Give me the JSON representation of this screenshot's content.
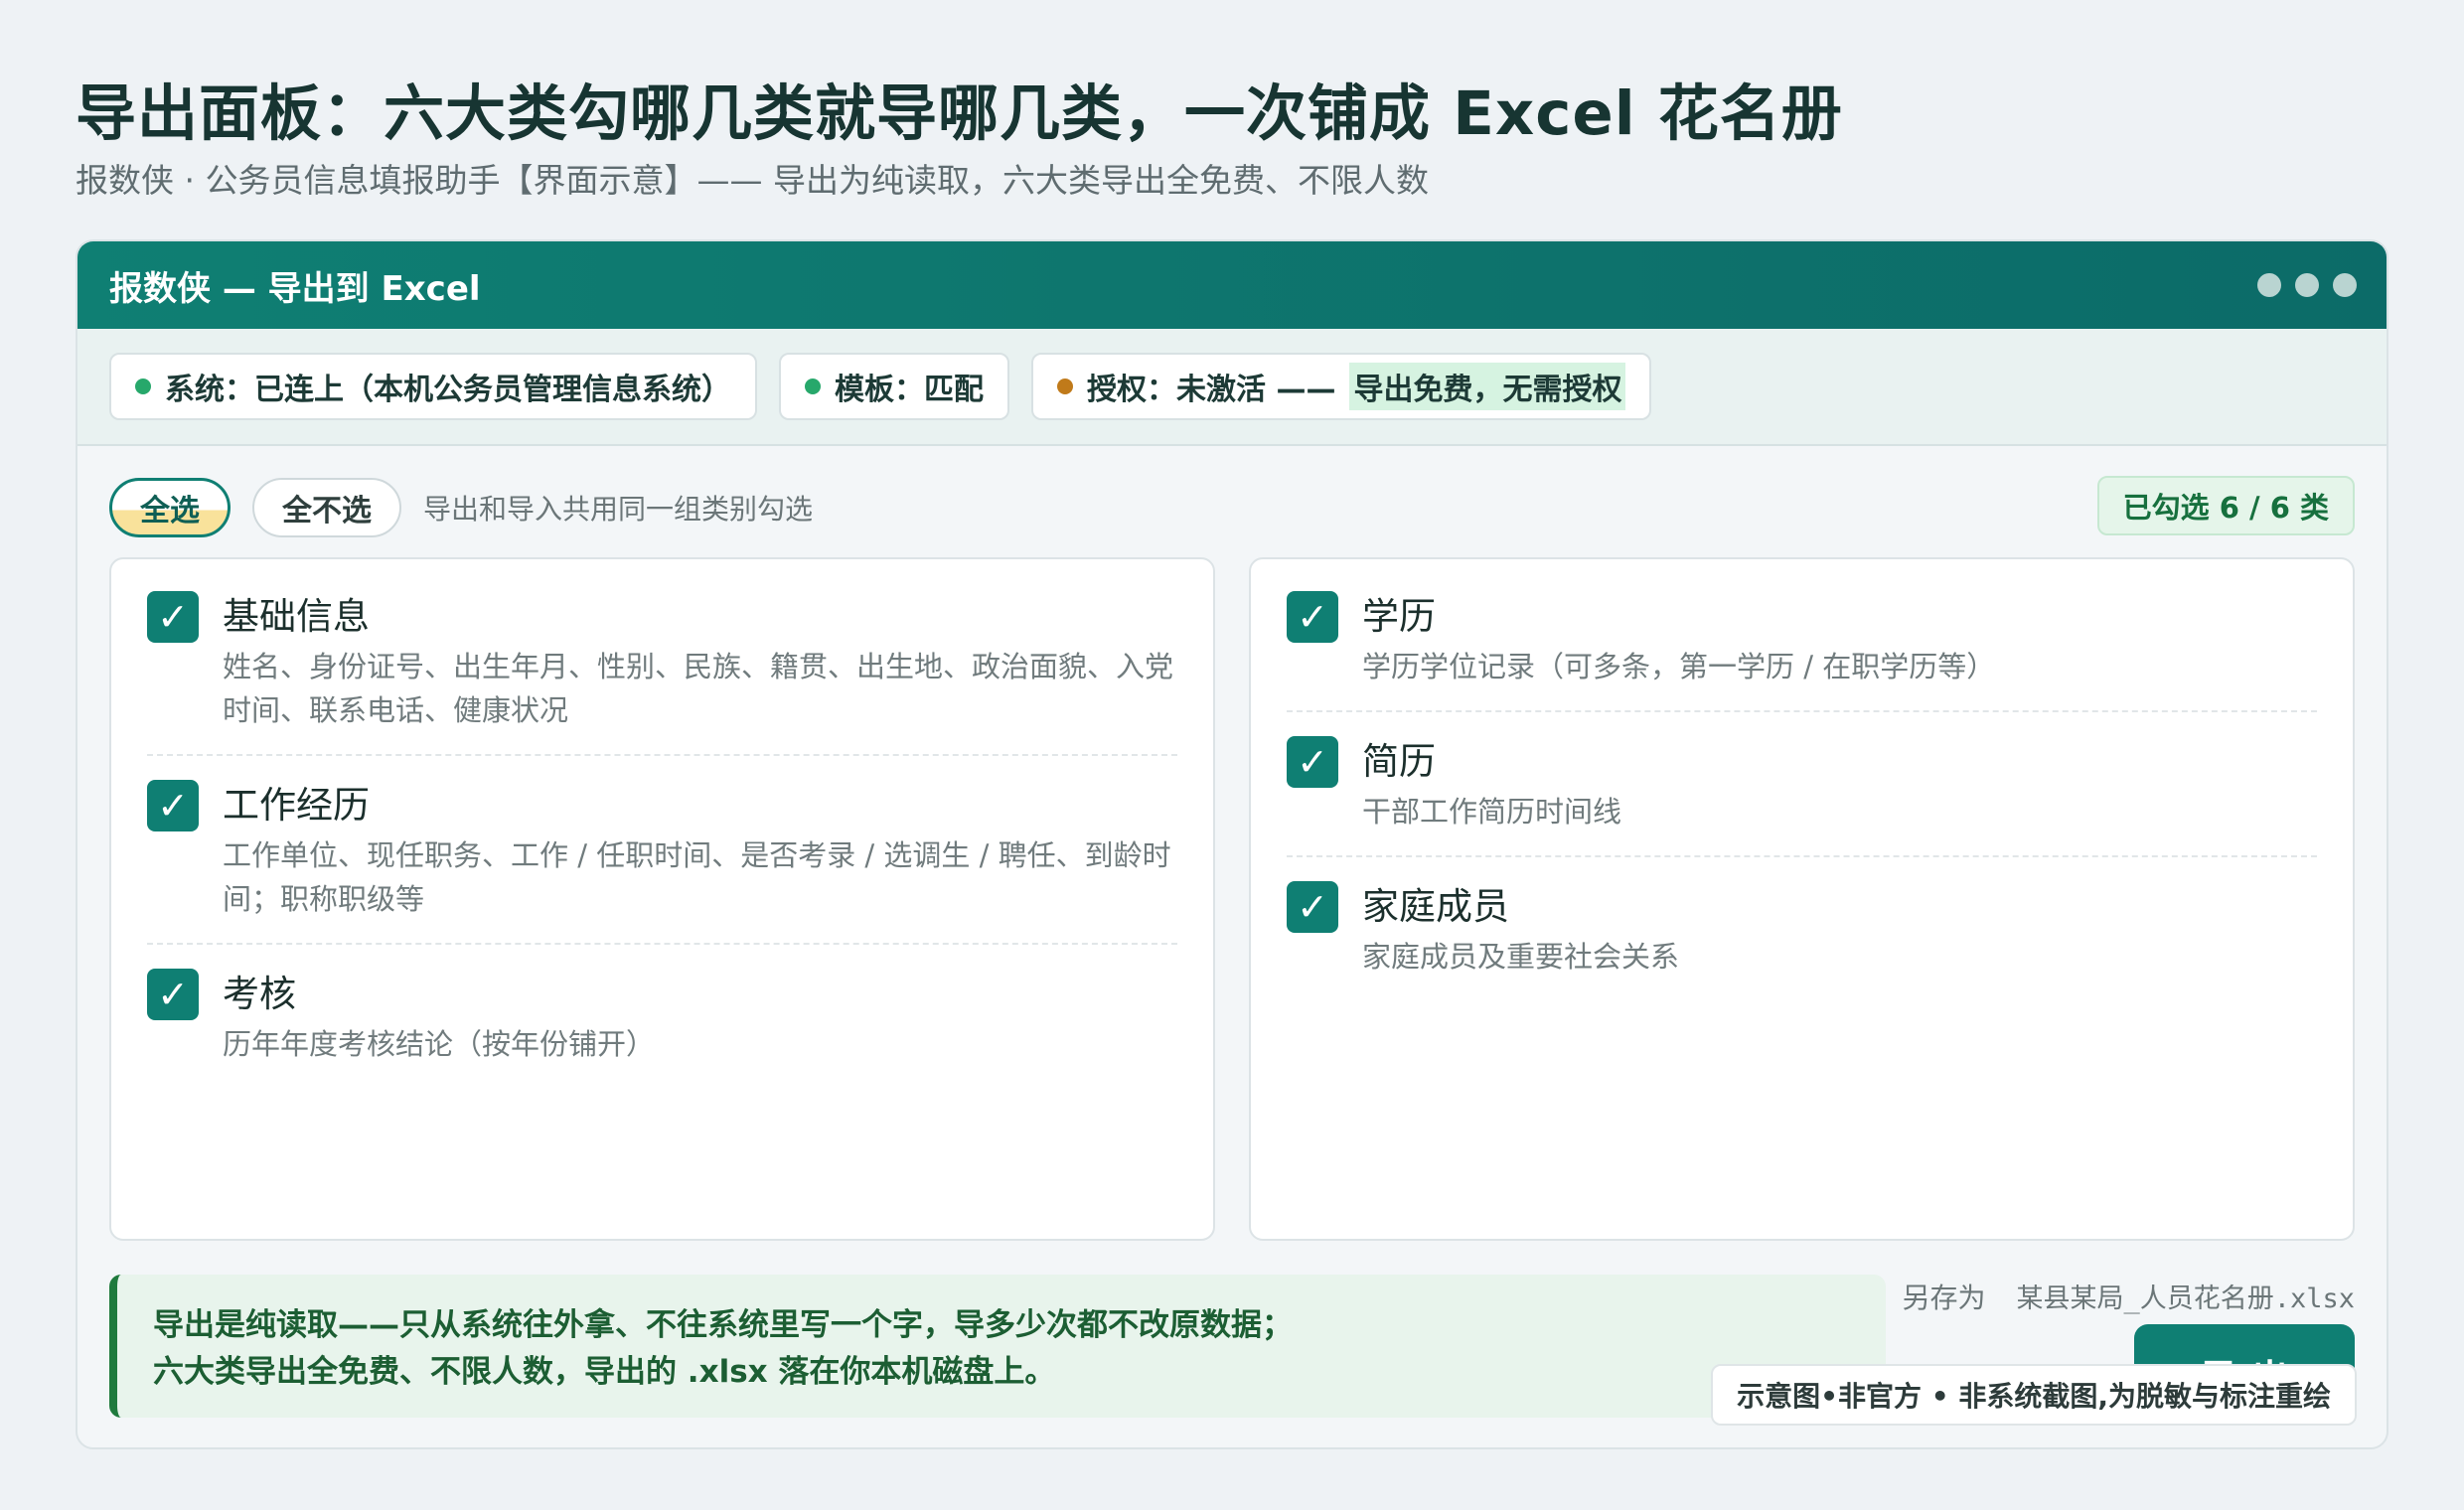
{
  "page": {
    "title": "导出面板：六大类勾哪几类就导哪几类，一次铺成 Excel 花名册",
    "subtitle": "报数侠 · 公务员信息填报助手【界面示意】—— 导出为纯读取，六大类导出全免费、不限人数"
  },
  "window": {
    "title": "报数侠 — 导出到 Excel"
  },
  "status": {
    "system": "系统：已连上（本机公务员管理信息系统）",
    "template": "模板：匹配",
    "license_prefix": "授权：未激活 ——",
    "license_highlight": "导出免费，无需授权"
  },
  "toolbar": {
    "select_all": "全选",
    "select_none": "全不选",
    "hint": "导出和导入共用同一组类别勾选",
    "count": "已勾选 6 / 6 类"
  },
  "categories_left": [
    {
      "check": "✓",
      "title": "基础信息",
      "desc": "姓名、身份证号、出生年月、性别、民族、籍贯、出生地、政治面貌、入党时间、联系电话、健康状况"
    },
    {
      "check": "✓",
      "title": "工作经历",
      "desc": "工作单位、现任职务、工作 / 任职时间、是否考录 / 选调生 / 聘任、到龄时间；职称职级等"
    },
    {
      "check": "✓",
      "title": "考核",
      "desc": "历年年度考核结论（按年份铺开）"
    }
  ],
  "categories_right": [
    {
      "check": "✓",
      "title": "学历",
      "desc": "学历学位记录（可多条，第一学历 / 在职学历等）"
    },
    {
      "check": "✓",
      "title": "简历",
      "desc": "干部工作简历时间线"
    },
    {
      "check": "✓",
      "title": "家庭成员",
      "desc": "家庭成员及重要社会关系"
    }
  ],
  "footer": {
    "note_line1": "导出是纯读取——只从系统往外拿、不往系统里写一个字，导多少次都不改原数据；",
    "note_line2": "六大类导出全免费、不限人数，导出的 .xlsx 落在你本机磁盘上。",
    "saveas_label": "另存为",
    "saveas_file": "某县某局_人员花名册.xlsx",
    "export_button": "导 出",
    "watermark": "示意图•非官方 • 非系统截图,为脱敏与标注重绘"
  },
  "colors": {
    "brand": "#0f7f73",
    "status_ok": "#27a86b",
    "status_warn": "#c07a1a"
  }
}
